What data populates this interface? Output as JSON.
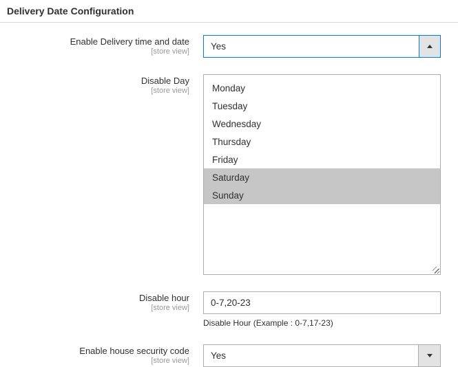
{
  "section": {
    "title": "Delivery Date Configuration"
  },
  "fields": {
    "enable": {
      "label": "Enable Delivery time and date",
      "scope": "[store view]",
      "value": "Yes",
      "open": true
    },
    "disable_day": {
      "label": "Disable Day",
      "scope": "[store view]",
      "options": [
        {
          "label": "Monday",
          "selected": false
        },
        {
          "label": "Tuesday",
          "selected": false
        },
        {
          "label": "Wednesday",
          "selected": false
        },
        {
          "label": "Thursday",
          "selected": false
        },
        {
          "label": "Friday",
          "selected": false
        },
        {
          "label": "Saturday",
          "selected": true
        },
        {
          "label": "Sunday",
          "selected": true
        }
      ]
    },
    "disable_hour": {
      "label": "Disable hour",
      "scope": "[store view]",
      "value": "0-7,20-23",
      "note": "Disable Hour (Example : 0-7,17-23)"
    },
    "enable_security": {
      "label": "Enable house security code",
      "scope": "[store view]",
      "value": "Yes",
      "open": false
    }
  }
}
